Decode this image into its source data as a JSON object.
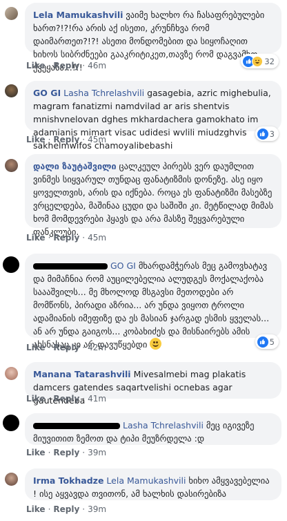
{
  "actions": {
    "like": "Like",
    "reply": "Reply",
    "sep": "·"
  },
  "comments": [
    {
      "author": "Lela Mamukashvili",
      "text": "ვაიმე ხალხო რა ჩასაფრებულები ხართ?!?!რა არის აქ ისეთი, კრუნჩხვა რომ დაიმართეთ?!?! ასეთი მონდომებით და სიყოჩაღით ხიხოს სიბრძნეები გააკრიტიკეთ,თავზე რომ დაგვამხო ქვეყანა...!!!",
      "time": "46m",
      "reactions": "32"
    },
    {
      "author": "GO GI",
      "tag": "Lasha Tchrelashvili",
      "text": "gasagebia, azric mighebulia, magram fanatizmi namdvilad ar aris shentvis mnishvnelovan dghes mkhardachera gamokhato im adamianis mimart visac udidesi wvlili miudzghvis sakhelmwifos chamoyalibebashi",
      "time": "45m",
      "reactions": "3"
    },
    {
      "author": "დალი ზაუტაშვილი",
      "text": "ცალკეულ პირებს ვერ დაუმლით ვინმეს სიყვარულ თუნდაც ფანატიზმის დონეზე. ასე იყო ყოველთვის, არის და იქნება. როცა ეს ფანატიზმი მასებზე ვრცელდება, მაშინაა ცუდი და საშიში კი. მეტწილად მიმას ხომ მომდევრები ჰყავს და არა მასზე შეყვარებული ფანკლუბი.",
      "time": "45m"
    },
    {
      "tag": "GO GI",
      "text": "მხარდამჭერას მეც გამოვხატავ და მიმაჩნია რომ აუცილებელია ალუდგეს მოქალაქობა საააშვილს... მე მხოლოდ მსგავსი მეთოდები არ მომწონს, პირადი აზრია... არ უნდა ვიყოთ ტროლი ადამიანის იმეფიზე და ეს მასიან ჯარგად ესმის ყველას... ან არ უნდა გაიგოს... კობახიძეს და მისნაირებს ამის ახსნასაც კი არ დავუწყებდი",
      "time": "42m",
      "reactions": "5"
    },
    {
      "author": "Manana Tatarashvili",
      "text": "Mivesalmebi mag plakatis damcers gatendes saqartvelishi ocnebas agar gautendeba",
      "time": "41m"
    },
    {
      "tag": "Lasha Tchrelashvili",
      "text": "მეც იგივეზე მიუვითით ზემოთ და ტიპი მეუზრდელა :დ",
      "time": "39m"
    },
    {
      "author": "Irma Tokhadze",
      "tag": "Lela Mamukashvili",
      "text": "ხიხო ამყვავებელია ! ისე აყვავდა თვითონ, ამ ხალხის დასირებიზა",
      "time": "39m"
    }
  ]
}
